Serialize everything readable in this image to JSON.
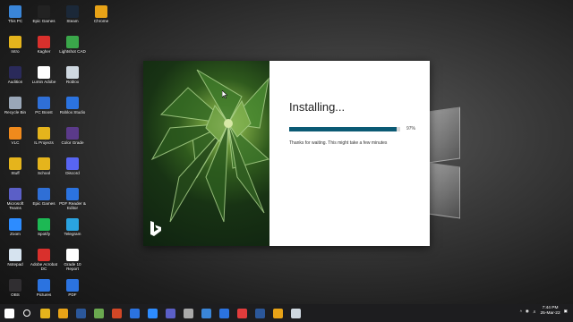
{
  "desktop": {
    "icons": [
      {
        "label": "This PC",
        "col": 0,
        "row": 0,
        "color": "#3a86d9",
        "icon": "computer-icon"
      },
      {
        "label": "Epic Games",
        "col": 1,
        "row": 0,
        "color": "#222222",
        "icon": "epic-games-icon"
      },
      {
        "label": "Steam",
        "col": 2,
        "row": 0,
        "color": "#1b2838",
        "icon": "steam-icon"
      },
      {
        "label": "Chrome",
        "col": 3,
        "row": 0,
        "color": "#e8a317",
        "icon": "chrome-icon"
      },
      {
        "label": "Intro",
        "col": 0,
        "row": 1,
        "color": "#e5b41c",
        "icon": "folder-icon"
      },
      {
        "label": "Kagher",
        "col": 1,
        "row": 1,
        "color": "#d9302c",
        "icon": "app-icon"
      },
      {
        "label": "Lightshot CAD",
        "col": 2,
        "row": 1,
        "color": "#3aa74a",
        "icon": "app-icon"
      },
      {
        "label": "Audition",
        "col": 0,
        "row": 2,
        "color": "#2a2a5a",
        "icon": "app-icon"
      },
      {
        "label": "Lumin Adobe",
        "col": 1,
        "row": 2,
        "color": "#ffffff",
        "icon": "document-icon"
      },
      {
        "label": "Roblox",
        "col": 2,
        "row": 2,
        "color": "#cfd8e0",
        "icon": "roblox-icon"
      },
      {
        "label": "Recycle Bin",
        "col": 0,
        "row": 3,
        "color": "#9aa7b8",
        "icon": "recycle-bin-icon"
      },
      {
        "label": "PC Boost",
        "col": 1,
        "row": 3,
        "color": "#2f6fd6",
        "icon": "app-icon"
      },
      {
        "label": "Roblox Studio",
        "col": 2,
        "row": 3,
        "color": "#2b73e0",
        "icon": "roblox-studio-icon"
      },
      {
        "label": "VLC",
        "col": 0,
        "row": 4,
        "color": "#f08a1c",
        "icon": "vlc-icon"
      },
      {
        "label": "IL Projects",
        "col": 1,
        "row": 4,
        "color": "#e5b41c",
        "icon": "folder-icon"
      },
      {
        "label": "Color Grade",
        "col": 2,
        "row": 4,
        "color": "#5b3a8a",
        "icon": "app-icon"
      },
      {
        "label": "Stuff",
        "col": 0,
        "row": 5,
        "color": "#e5b41c",
        "icon": "folder-icon"
      },
      {
        "label": "School",
        "col": 1,
        "row": 5,
        "color": "#e5b41c",
        "icon": "folder-icon"
      },
      {
        "label": "Discord",
        "col": 2,
        "row": 5,
        "color": "#5865f2",
        "icon": "discord-icon"
      },
      {
        "label": "Microsoft Teams",
        "col": 0,
        "row": 6,
        "color": "#5b5fc7",
        "icon": "teams-icon"
      },
      {
        "label": "Epic Games",
        "col": 1,
        "row": 6,
        "color": "#2f6fd6",
        "icon": "app-icon"
      },
      {
        "label": "PDF Reader & Editor",
        "col": 2,
        "row": 6,
        "color": "#2b73e0",
        "icon": "pdf-icon"
      },
      {
        "label": "Zoom",
        "col": 0,
        "row": 7,
        "color": "#2d8cff",
        "icon": "zoom-icon"
      },
      {
        "label": "Spotify",
        "col": 1,
        "row": 7,
        "color": "#1db954",
        "icon": "spotify-icon"
      },
      {
        "label": "Telegram",
        "col": 2,
        "row": 7,
        "color": "#2aa3e0",
        "icon": "telegram-icon"
      },
      {
        "label": "Notepad",
        "col": 0,
        "row": 8,
        "color": "#d6e3ef",
        "icon": "notepad-icon"
      },
      {
        "label": "Adobe Acrobat DC",
        "col": 1,
        "row": 8,
        "color": "#d9302c",
        "icon": "acrobat-icon"
      },
      {
        "label": "Grade 10 Report",
        "col": 2,
        "row": 8,
        "color": "#ffffff",
        "icon": "document-icon"
      },
      {
        "label": "OBS",
        "col": 0,
        "row": 9,
        "color": "#302e31",
        "icon": "obs-icon"
      },
      {
        "label": "Pictures",
        "col": 1,
        "row": 9,
        "color": "#2b73e0",
        "icon": "pictures-icon"
      },
      {
        "label": "PDF",
        "col": 2,
        "row": 9,
        "color": "#2b73e0",
        "icon": "pdf-icon"
      }
    ]
  },
  "installer": {
    "title": "Installing...",
    "progress_percent": 97,
    "progress_label": "97%",
    "message": "Thanks for waiting. This might take a few minutes",
    "brand_icon": "bing-logo-icon",
    "colors": {
      "progress": "#0b5a74",
      "track": "#d9d9d9"
    }
  },
  "taskbar": {
    "items": [
      {
        "name": "start-button",
        "icon": "windows-icon",
        "color": "#ffffff"
      },
      {
        "name": "search-button",
        "icon": "search-icon",
        "color": "#ffffff"
      },
      {
        "name": "taskbar-app-explorer",
        "icon": "folder-icon",
        "color": "#e5b41c"
      },
      {
        "name": "taskbar-app-chrome",
        "icon": "chrome-icon",
        "color": "#e8a317"
      },
      {
        "name": "taskbar-app-word",
        "icon": "word-icon",
        "color": "#2b579a"
      },
      {
        "name": "taskbar-app-minecraft",
        "icon": "minecraft-icon",
        "color": "#6aa84f"
      },
      {
        "name": "taskbar-app-powerpoint",
        "icon": "powerpoint-icon",
        "color": "#d24726"
      },
      {
        "name": "taskbar-app-pictures",
        "icon": "pictures-icon",
        "color": "#2b73e0"
      },
      {
        "name": "taskbar-app-zoom",
        "icon": "zoom-icon",
        "color": "#2d8cff"
      },
      {
        "name": "taskbar-app-teams",
        "icon": "teams-icon",
        "color": "#5b5fc7"
      },
      {
        "name": "taskbar-app-settings",
        "icon": "gear-icon",
        "color": "#aaaaaa"
      },
      {
        "name": "taskbar-app-photos",
        "icon": "photos-icon",
        "color": "#3a86d9"
      },
      {
        "name": "taskbar-app-mail",
        "icon": "mail-icon",
        "color": "#2b73e0"
      },
      {
        "name": "taskbar-app-paint",
        "icon": "paint-icon",
        "color": "#e23c3c"
      },
      {
        "name": "taskbar-app-word2",
        "icon": "word-icon",
        "color": "#2b579a"
      },
      {
        "name": "taskbar-app-office",
        "icon": "office-icon",
        "color": "#e8a317"
      },
      {
        "name": "taskbar-app-roblox",
        "icon": "roblox-icon",
        "color": "#cfd8e0"
      }
    ],
    "clock": {
      "time": "7:44 PM",
      "date": "25-Mar-22"
    }
  }
}
